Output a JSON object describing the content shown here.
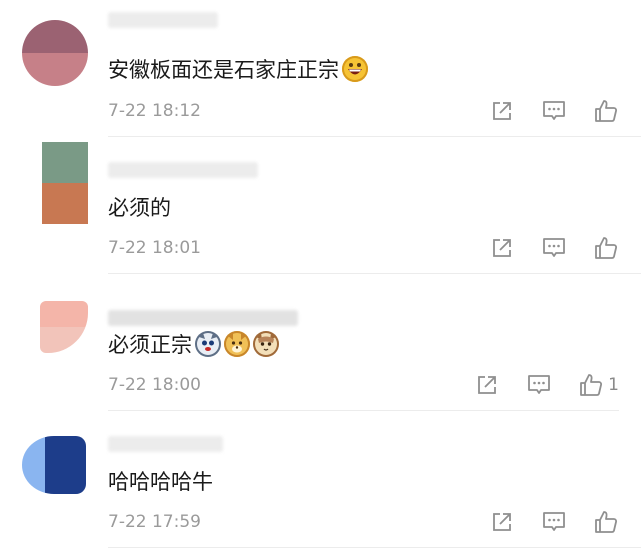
{
  "comments": [
    {
      "text": "安徽板面还是石家庄正宗",
      "emoji": [
        "grinning-face-emoji"
      ],
      "time": "7-22 18:12",
      "likes": "",
      "avatar_colors": [
        "#9b6272",
        "#c68088"
      ]
    },
    {
      "text": "必须的",
      "emoji": [],
      "time": "7-22 18:01",
      "likes": "",
      "avatar_colors": [
        "#7a9a86",
        "#c87852"
      ]
    },
    {
      "text": "必须正宗",
      "emoji": [
        "husky-dog-emoji",
        "shiba-dog-emoji",
        "cat-emoji"
      ],
      "time": "7-22 18:00",
      "likes": "1",
      "avatar_colors": [
        "#f4b5a9",
        "#f2c4ba"
      ]
    },
    {
      "text": "哈哈哈哈牛",
      "emoji": [],
      "time": "7-22 17:59",
      "likes": "",
      "avatar_colors": [
        "#1d3d8a",
        "#5f86c9"
      ]
    }
  ],
  "icons": {
    "share": "share-icon",
    "reply": "comment-icon",
    "like": "thumbs-up-icon"
  },
  "colors": {
    "text": "#1a1a1a",
    "meta": "#9a9a9a",
    "icon": "#8f8f8f",
    "divider": "#ececec"
  }
}
